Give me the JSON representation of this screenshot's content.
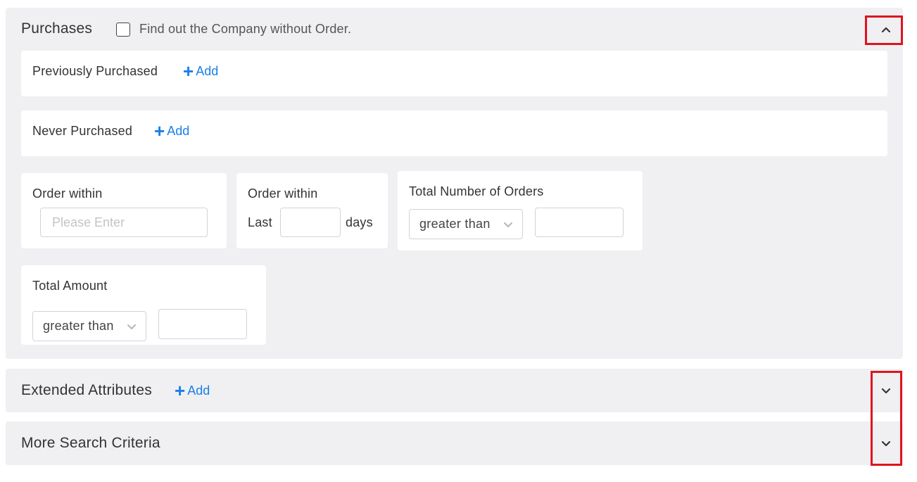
{
  "purchases": {
    "title": "Purchases",
    "checkbox_label": "Find out the Company without Order.",
    "checkbox_checked": false,
    "collapse_icon": "chevron-up-icon",
    "previously_purchased": {
      "label": "Previously Purchased",
      "add_label": "Add"
    },
    "never_purchased": {
      "label": "Never Purchased",
      "add_label": "Add"
    },
    "order_within_date": {
      "title": "Order within",
      "placeholder": "Please Enter",
      "value": ""
    },
    "order_within_last": {
      "title": "Order within",
      "prefix": "Last",
      "suffix": "days",
      "value": ""
    },
    "total_orders": {
      "title": "Total Number of Orders",
      "operator": "greater than",
      "value": ""
    },
    "total_amount": {
      "title": "Total Amount",
      "operator": "greater than",
      "value": ""
    }
  },
  "extended_attributes": {
    "title": "Extended Attributes",
    "add_label": "Add",
    "expand_icon": "chevron-down-icon"
  },
  "more_search_criteria": {
    "title": "More Search Criteria",
    "expand_icon": "chevron-down-icon"
  },
  "colors": {
    "accent": "#1a7fe8",
    "panel_bg": "#f0f0f2",
    "highlight": "#e0141e"
  }
}
